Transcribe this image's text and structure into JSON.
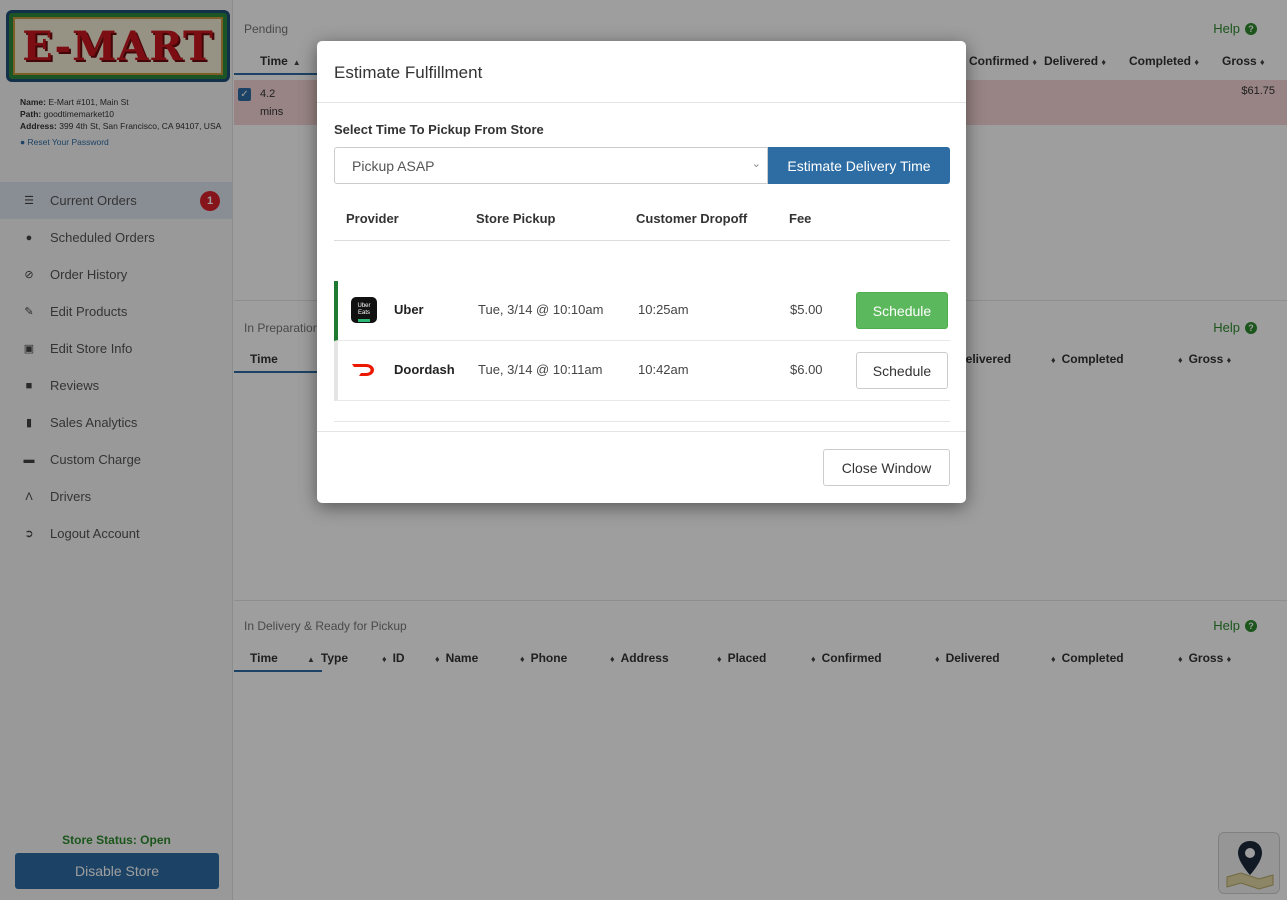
{
  "logo_text": "E-MART",
  "store": {
    "name_label": "Name:",
    "name": "E-Mart #101, Main St",
    "path_label": "Path:",
    "path": "goodtimemarket10",
    "address_label": "Address:",
    "address": "399 4th St, San Francisco, CA 94107, USA",
    "reset_label": "Reset Your Password"
  },
  "nav": [
    {
      "label": "Current Orders",
      "icon": "bars-icon",
      "badge": "1"
    },
    {
      "label": "Scheduled Orders",
      "icon": "clock-icon"
    },
    {
      "label": "Order History",
      "icon": "history-icon"
    },
    {
      "label": "Edit Products",
      "icon": "edit-icon"
    },
    {
      "label": "Edit Store Info",
      "icon": "store-icon"
    },
    {
      "label": "Reviews",
      "icon": "comment-icon"
    },
    {
      "label": "Sales Analytics",
      "icon": "chart-icon"
    },
    {
      "label": "Custom Charge",
      "icon": "card-icon"
    },
    {
      "label": "Drivers",
      "icon": "road-icon"
    },
    {
      "label": "Logout Account",
      "icon": "logout-icon"
    }
  ],
  "store_status": "Store Status: Open",
  "disable_label": "Disable Store",
  "panels": {
    "pending": {
      "title": "Pending",
      "help": "Help",
      "headers_visible": [
        "Time",
        "Confirmed",
        "Delivered",
        "Completed",
        "Gross"
      ],
      "row": {
        "time_value": "4.2",
        "time_unit": "mins",
        "gross": "$61.75"
      }
    },
    "preparation": {
      "title": "In Preparation",
      "help": "Help",
      "headers_visible": [
        "Time",
        "Delivered",
        "Completed",
        "Gross"
      ]
    },
    "delivery": {
      "title": "In Delivery & Ready for Pickup",
      "help": "Help",
      "headers": [
        "Time",
        "Type",
        "ID",
        "Name",
        "Phone",
        "Address",
        "Placed",
        "Confirmed",
        "Delivered",
        "Completed",
        "Gross"
      ]
    }
  },
  "modal": {
    "title": "Estimate Fulfillment",
    "select_label": "Select Time To Pickup From Store",
    "select_value": "Pickup ASAP",
    "estimate_label": "Estimate Delivery Time",
    "columns": [
      "Provider",
      "Store Pickup",
      "Customer Dropoff",
      "Fee"
    ],
    "providers": [
      {
        "name": "Uber",
        "logo": "uber-icon",
        "pickup": "Tue, 3/14 @ 10:10am",
        "dropoff": "10:25am",
        "fee": "$5.00",
        "action": "Schedule",
        "selected": true
      },
      {
        "name": "Doordash",
        "logo": "doordash-icon",
        "pickup": "Tue, 3/14 @ 10:11am",
        "dropoff": "10:42am",
        "fee": "$6.00",
        "action": "Schedule",
        "selected": false
      }
    ],
    "close_label": "Close Window"
  },
  "colors": {
    "primary": "#2e6da4",
    "success": "#5cb85c",
    "danger": "#d9232d",
    "pending_row": "#f6d5d5",
    "help": "#2e8b2e"
  }
}
